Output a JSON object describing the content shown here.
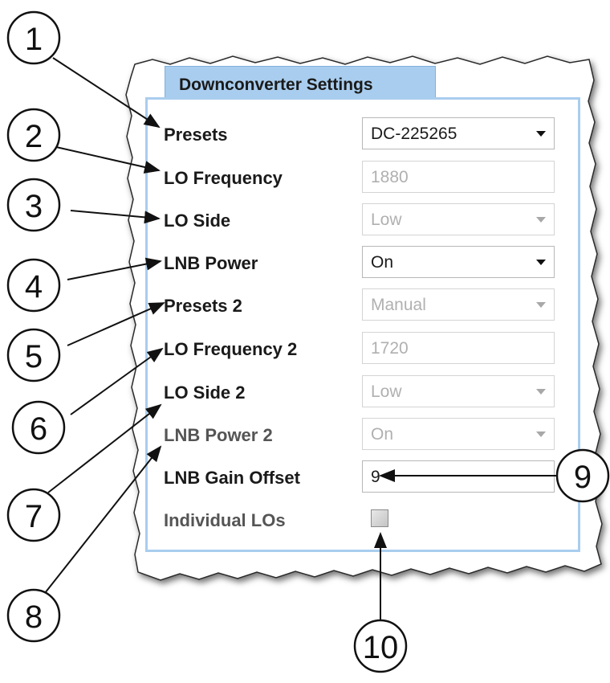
{
  "panel": {
    "tab_title": "Downconverter Settings",
    "rows": [
      {
        "label": "Presets",
        "value": "DC-225265",
        "kind": "dropdown",
        "enabled": true
      },
      {
        "label": "LO Frequency",
        "value": "1880",
        "kind": "text",
        "enabled": false
      },
      {
        "label": "LO Side",
        "value": "Low",
        "kind": "dropdown",
        "enabled": false
      },
      {
        "label": "LNB Power",
        "value": "On",
        "kind": "dropdown",
        "enabled": true
      },
      {
        "label": "Presets 2",
        "value": "Manual",
        "kind": "dropdown",
        "enabled": false
      },
      {
        "label": "LO Frequency 2",
        "value": "1720",
        "kind": "text",
        "enabled": false
      },
      {
        "label": "LO Side 2",
        "value": "Low",
        "kind": "dropdown",
        "enabled": false
      },
      {
        "label": "LNB Power 2",
        "value": "On",
        "kind": "dropdown",
        "enabled": false
      },
      {
        "label": "LNB Gain Offset",
        "value": "9",
        "kind": "text",
        "enabled": true
      },
      {
        "label": "Individual LOs",
        "checked": false,
        "kind": "checkbox",
        "enabled": true
      }
    ]
  },
  "callouts": [
    "1",
    "2",
    "3",
    "4",
    "5",
    "6",
    "7",
    "8",
    "9",
    "10"
  ],
  "colors": {
    "tab_fill": "#a9cdee",
    "panel_border": "#a9cdee",
    "disabled_text": "#b0b0b0"
  }
}
